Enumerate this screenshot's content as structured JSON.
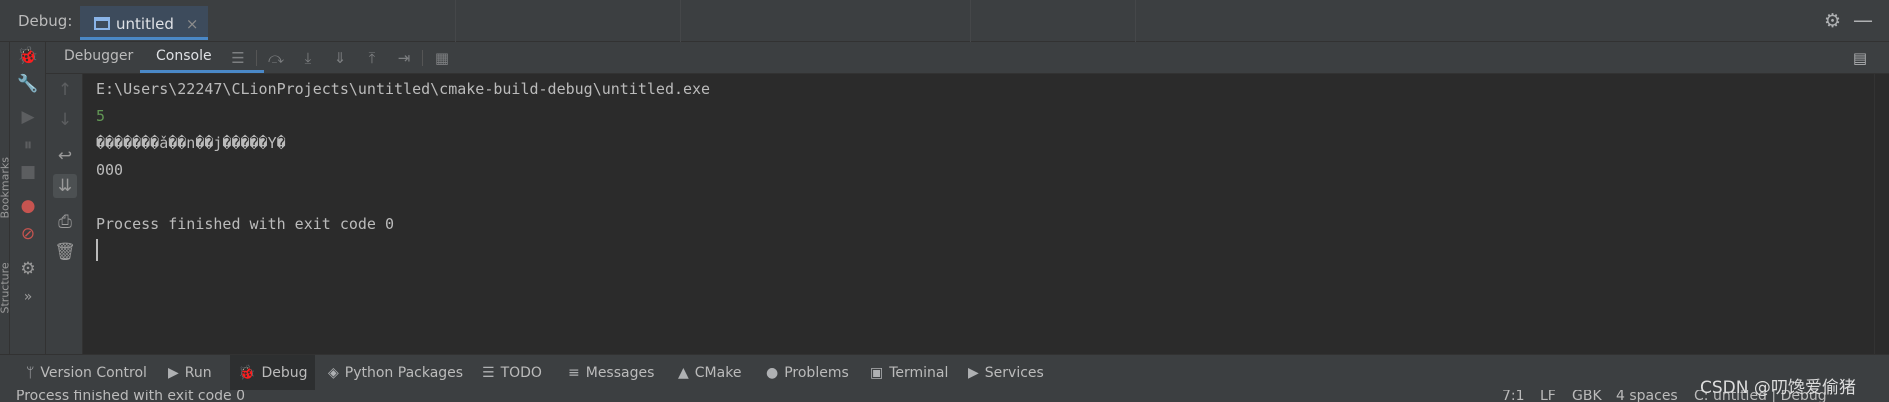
{
  "topbar": {
    "label": "Debug:",
    "session_tab": "untitled",
    "close_glyph": "×",
    "gear_glyph": "⚙",
    "hide_glyph": "—"
  },
  "left_strip": {
    "vertical_labels": [
      "Bookmarks",
      "Structure"
    ]
  },
  "side_tools": [
    {
      "name": "bug-icon",
      "glyph": "🐞"
    },
    {
      "name": "wrench-icon",
      "glyph": "🔧"
    },
    {
      "name": "resume-icon",
      "glyph": "▶"
    },
    {
      "name": "pause-icon",
      "glyph": "⏸"
    },
    {
      "name": "stop-icon",
      "glyph": "■"
    },
    {
      "name": "view-breakpoints-icon",
      "glyph": "●"
    },
    {
      "name": "mute-breakpoints-icon",
      "glyph": "⊘"
    },
    {
      "name": "settings-icon",
      "glyph": "⚙"
    },
    {
      "name": "more-icon",
      "glyph": "»"
    }
  ],
  "debug_toolbar": {
    "tabs": [
      "Debugger",
      "Console"
    ],
    "active_tab": "Console",
    "icons": [
      {
        "name": "menu-icon",
        "glyph": "☰"
      },
      {
        "name": "step-over-icon",
        "glyph": "⤼"
      },
      {
        "name": "step-into-icon",
        "glyph": "⤓"
      },
      {
        "name": "force-step-into-icon",
        "glyph": "⇓"
      },
      {
        "name": "step-out-icon",
        "glyph": "⤒"
      },
      {
        "name": "run-to-cursor-icon",
        "glyph": "⇥"
      },
      {
        "name": "evaluate-icon",
        "glyph": "▦"
      }
    ],
    "layout_glyph": "▤"
  },
  "console_tools": [
    {
      "name": "up-arrow-icon",
      "glyph": "↑"
    },
    {
      "name": "down-arrow-icon",
      "glyph": "↓"
    },
    {
      "name": "soft-wrap-icon",
      "glyph": "↩"
    },
    {
      "name": "scroll-to-end-icon",
      "glyph": "⇊"
    },
    {
      "name": "print-icon",
      "glyph": "⎙"
    },
    {
      "name": "trash-icon",
      "glyph": "🗑"
    }
  ],
  "console": {
    "lines": [
      {
        "text": "E:\\Users\\22247\\CLionProjects\\untitled\\cmake-build-debug\\untitled.exe",
        "color": "#bbbbbb"
      },
      {
        "text": "5",
        "color": "#629755"
      },
      {
        "text": "�������ǎ��n��j�����Y�",
        "color": "#bbbbbb"
      },
      {
        "text": "000",
        "color": "#bbbbbb"
      },
      {
        "text": "",
        "color": "#bbbbbb"
      },
      {
        "text": "Process finished with exit code 0",
        "color": "#bbbbbb"
      }
    ]
  },
  "bottom_tabs": [
    {
      "label": "Version Control",
      "icon": "ᛘ",
      "icon_name": "branch-icon"
    },
    {
      "label": "Run",
      "icon": "▶",
      "icon_name": "run-icon"
    },
    {
      "label": "Debug",
      "icon": "🐞",
      "icon_name": "debug-icon",
      "active": true
    },
    {
      "label": "Python Packages",
      "icon": "◈",
      "icon_name": "layers-icon"
    },
    {
      "label": "TODO",
      "icon": "☰",
      "icon_name": "list-icon"
    },
    {
      "label": "Messages",
      "icon": "≡",
      "icon_name": "messages-icon"
    },
    {
      "label": "CMake",
      "icon": "▲",
      "icon_name": "cmake-icon"
    },
    {
      "label": "Problems",
      "icon": "●",
      "icon_name": "problems-icon"
    },
    {
      "label": "Terminal",
      "icon": "▣",
      "icon_name": "terminal-icon"
    },
    {
      "label": "Services",
      "icon": "▶",
      "icon_name": "services-icon"
    }
  ],
  "status": {
    "message": "Process finished with exit code 0",
    "position": "7:1",
    "line_sep": "LF",
    "encoding": "GBK",
    "indent": "4 spaces",
    "context": "C: untitled | Debug"
  },
  "watermark": "CSDN @叨馋爱偷猪",
  "colors": {
    "background": "#2b2b2b",
    "panel": "#3c3f41",
    "accent": "#4a88c7",
    "text": "#bbbbbb",
    "number_output": "#629755"
  }
}
